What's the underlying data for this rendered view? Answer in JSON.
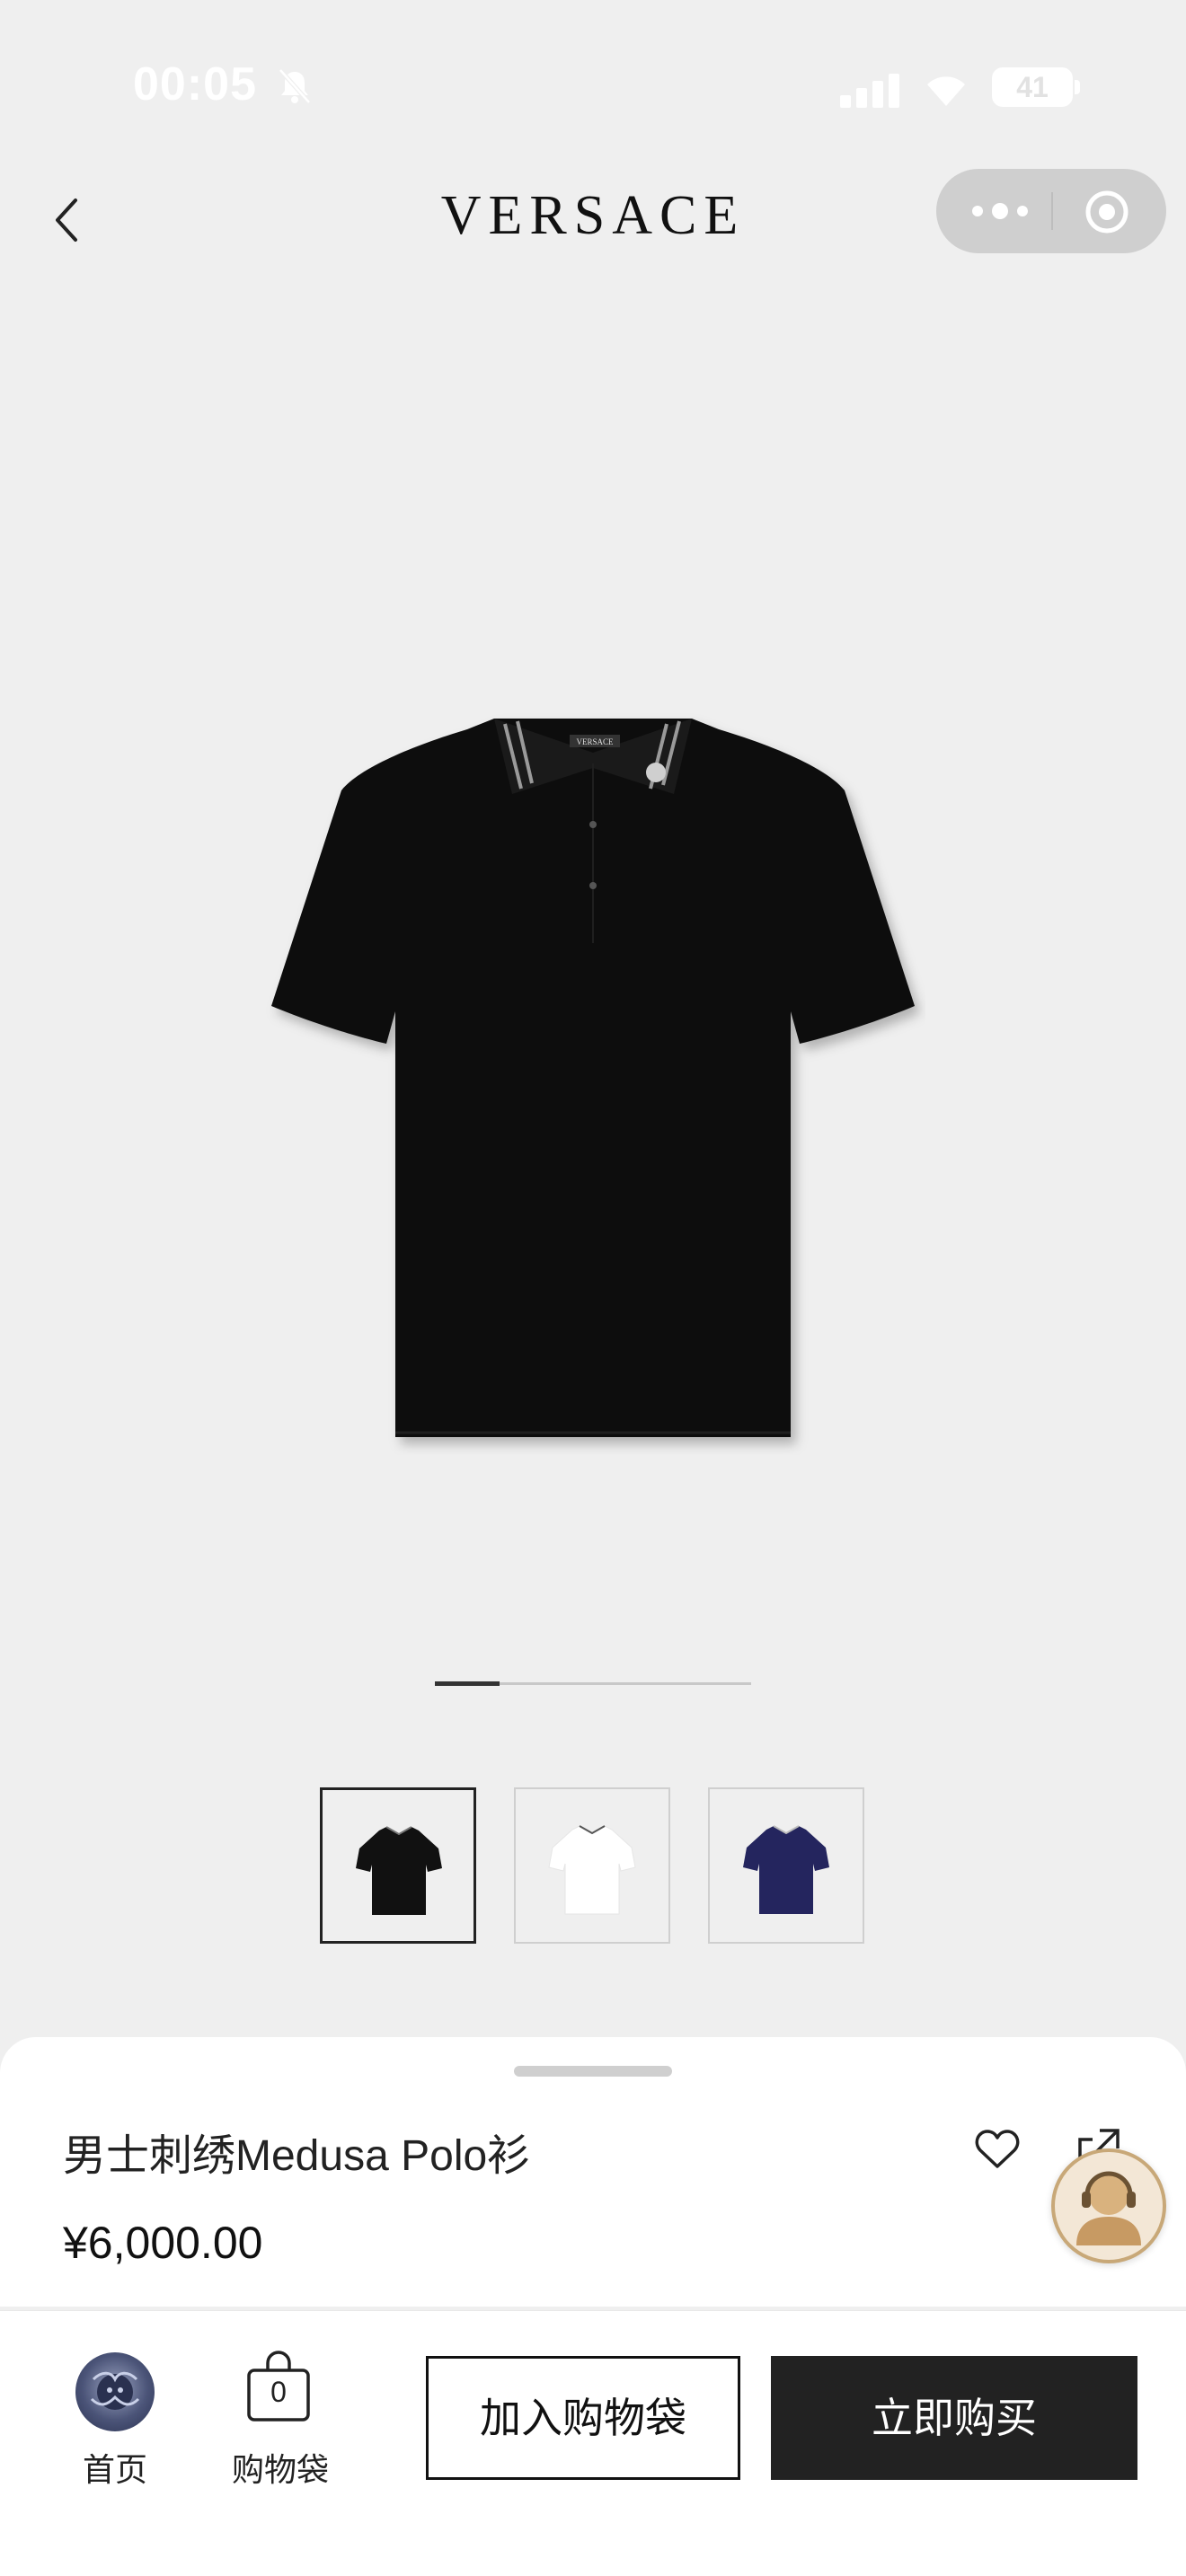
{
  "status_bar": {
    "time": "00:05",
    "battery": "41"
  },
  "header": {
    "brand": "VERSACE"
  },
  "gallery": {
    "pager_total": 5,
    "pager_active": 1
  },
  "thumbnails": [
    {
      "color": "#111111",
      "active": true
    },
    {
      "color": "#ffffff",
      "active": false
    },
    {
      "color": "#24255e",
      "active": false
    }
  ],
  "product": {
    "name": "男士刺绣Medusa Polo衫",
    "price": "¥6,000.00"
  },
  "action_bar": {
    "home_label": "首页",
    "bag_label": "购物袋",
    "bag_count": "0",
    "add_to_bag": "加入购物袋",
    "buy_now": "立即购买"
  }
}
